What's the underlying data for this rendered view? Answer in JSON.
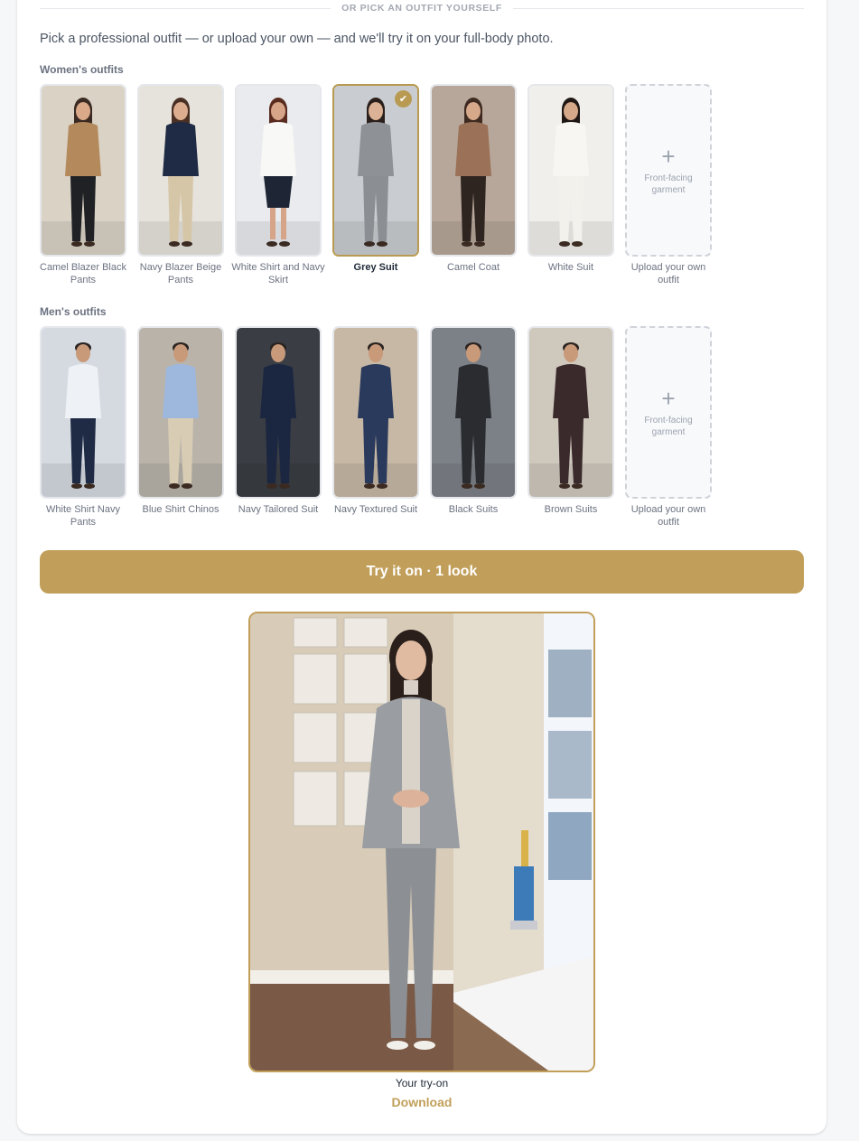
{
  "section_divider": "OR PICK AN OUTFIT YOURSELF",
  "intro": "Pick a professional outfit — or upload your own — and we'll try it on your full-body photo.",
  "women": {
    "title": "Women's outfits",
    "items": [
      {
        "label": "Camel Blazer Black Pants",
        "bg": "#d9d2c5",
        "top": "#b48a5c",
        "bottom": "#1f2124",
        "skin": "#d9a98a",
        "hair": "#3a2a22",
        "selected": false
      },
      {
        "label": "Navy Blazer Beige Pants",
        "bg": "#e6e3dc",
        "top": "#1f2a44",
        "bottom": "#d6c6a8",
        "skin": "#dcae8f",
        "hair": "#4a3024",
        "selected": false
      },
      {
        "label": "White Shirt and Navy Skirt",
        "bg": "#e9ebee",
        "top": "#f8f8f6",
        "bottom": "#1e2636",
        "skin": "#d6a488",
        "hair": "#5a2c20",
        "selected": false
      },
      {
        "label": "Grey Suit",
        "bg": "#c9ccd0",
        "top": "#8e9296",
        "bottom": "#8b8f93",
        "skin": "#dbb295",
        "hair": "#2a1f1a",
        "selected": true
      },
      {
        "label": "Camel Coat",
        "bg": "#b7a79a",
        "top": "#9b7257",
        "bottom": "#2e2420",
        "skin": "#d6a98b",
        "hair": "#3e2a20",
        "selected": false
      },
      {
        "label": "White Suit",
        "bg": "#f1efeb",
        "top": "#f7f6f2",
        "bottom": "#f3f1ec",
        "skin": "#d6a88a",
        "hair": "#1e1714",
        "selected": false
      }
    ],
    "upload": {
      "label": "Upload your own outfit",
      "hint": "Front-facing garment",
      "icon": "plus-icon"
    }
  },
  "men": {
    "title": "Men's outfits",
    "items": [
      {
        "label": "White Shirt Navy Pants",
        "bg": "#d4dae0",
        "top": "#eef2f6",
        "bottom": "#1f2a44",
        "skin": "#c99a7a",
        "hair": "#2a2320",
        "selected": false
      },
      {
        "label": "Blue Shirt Chinos",
        "bg": "#b9b3aa",
        "top": "#9db7dd",
        "bottom": "#d8ccb4",
        "skin": "#c99a7a",
        "hair": "#2a2320",
        "selected": false
      },
      {
        "label": "Navy Tailored Suit",
        "bg": "#3a3e44",
        "top": "#1b2640",
        "bottom": "#1b2640",
        "skin": "#c99a7a",
        "hair": "#2a2320",
        "selected": false
      },
      {
        "label": "Navy Textured Suit",
        "bg": "#c7b8a5",
        "top": "#2a3a5c",
        "bottom": "#2a3a5c",
        "skin": "#c99a7a",
        "hair": "#2a2320",
        "selected": false
      },
      {
        "label": "Black Suits",
        "bg": "#7c8087",
        "top": "#2a2c30",
        "bottom": "#2a2c30",
        "skin": "#c99a7a",
        "hair": "#2a2320",
        "selected": false
      },
      {
        "label": "Brown Suits",
        "bg": "#cfc8bd",
        "top": "#3a2a2c",
        "bottom": "#3a2a2c",
        "skin": "#c99a7a",
        "hair": "#2a2320",
        "selected": false
      }
    ],
    "upload": {
      "label": "Upload your own outfit",
      "hint": "Front-facing garment",
      "icon": "plus-icon"
    }
  },
  "cta": "Try it on · 1 look",
  "result": {
    "caption": "Your try-on",
    "download": "Download"
  },
  "colors": {
    "accent": "#c19f5a",
    "selected_border": "#b89a52"
  }
}
